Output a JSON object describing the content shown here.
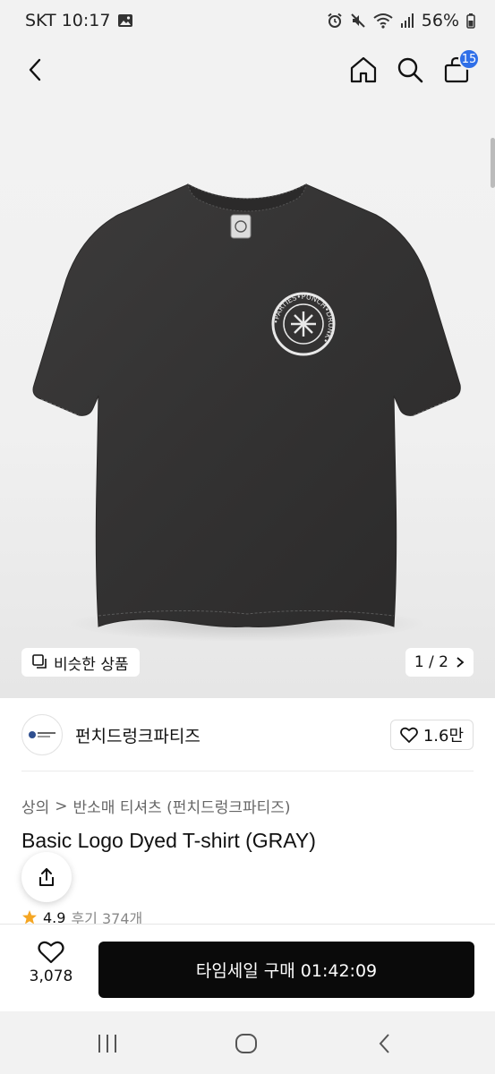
{
  "status_bar": {
    "carrier_time": "SKT 10:17",
    "battery": "56%"
  },
  "header": {
    "cart_count": "15"
  },
  "product_image": {
    "similar_label": "비슷한 상품",
    "pager": "1 / 2",
    "logo_text": "•PARTIES•PUNCH•DRUNK•"
  },
  "brand": {
    "name": "펀치드렁크파티즈",
    "likes": "1.6만"
  },
  "breadcrumb": {
    "category": "상의",
    "separator": ">",
    "subcategory": "반소매 티셔츠 (펀치드렁크파티즈)"
  },
  "product": {
    "title": "Basic Logo Dyed T-shirt (GRAY)",
    "rating": "4.9",
    "reviews": "후기 374개"
  },
  "bottom_bar": {
    "wish_count": "3,078",
    "buy_label": "타임세일 구매 01:42:09"
  },
  "colors": {
    "accent": "#2f6fe8",
    "buy_button": "#0a0a0a",
    "star": "#f5a623"
  }
}
